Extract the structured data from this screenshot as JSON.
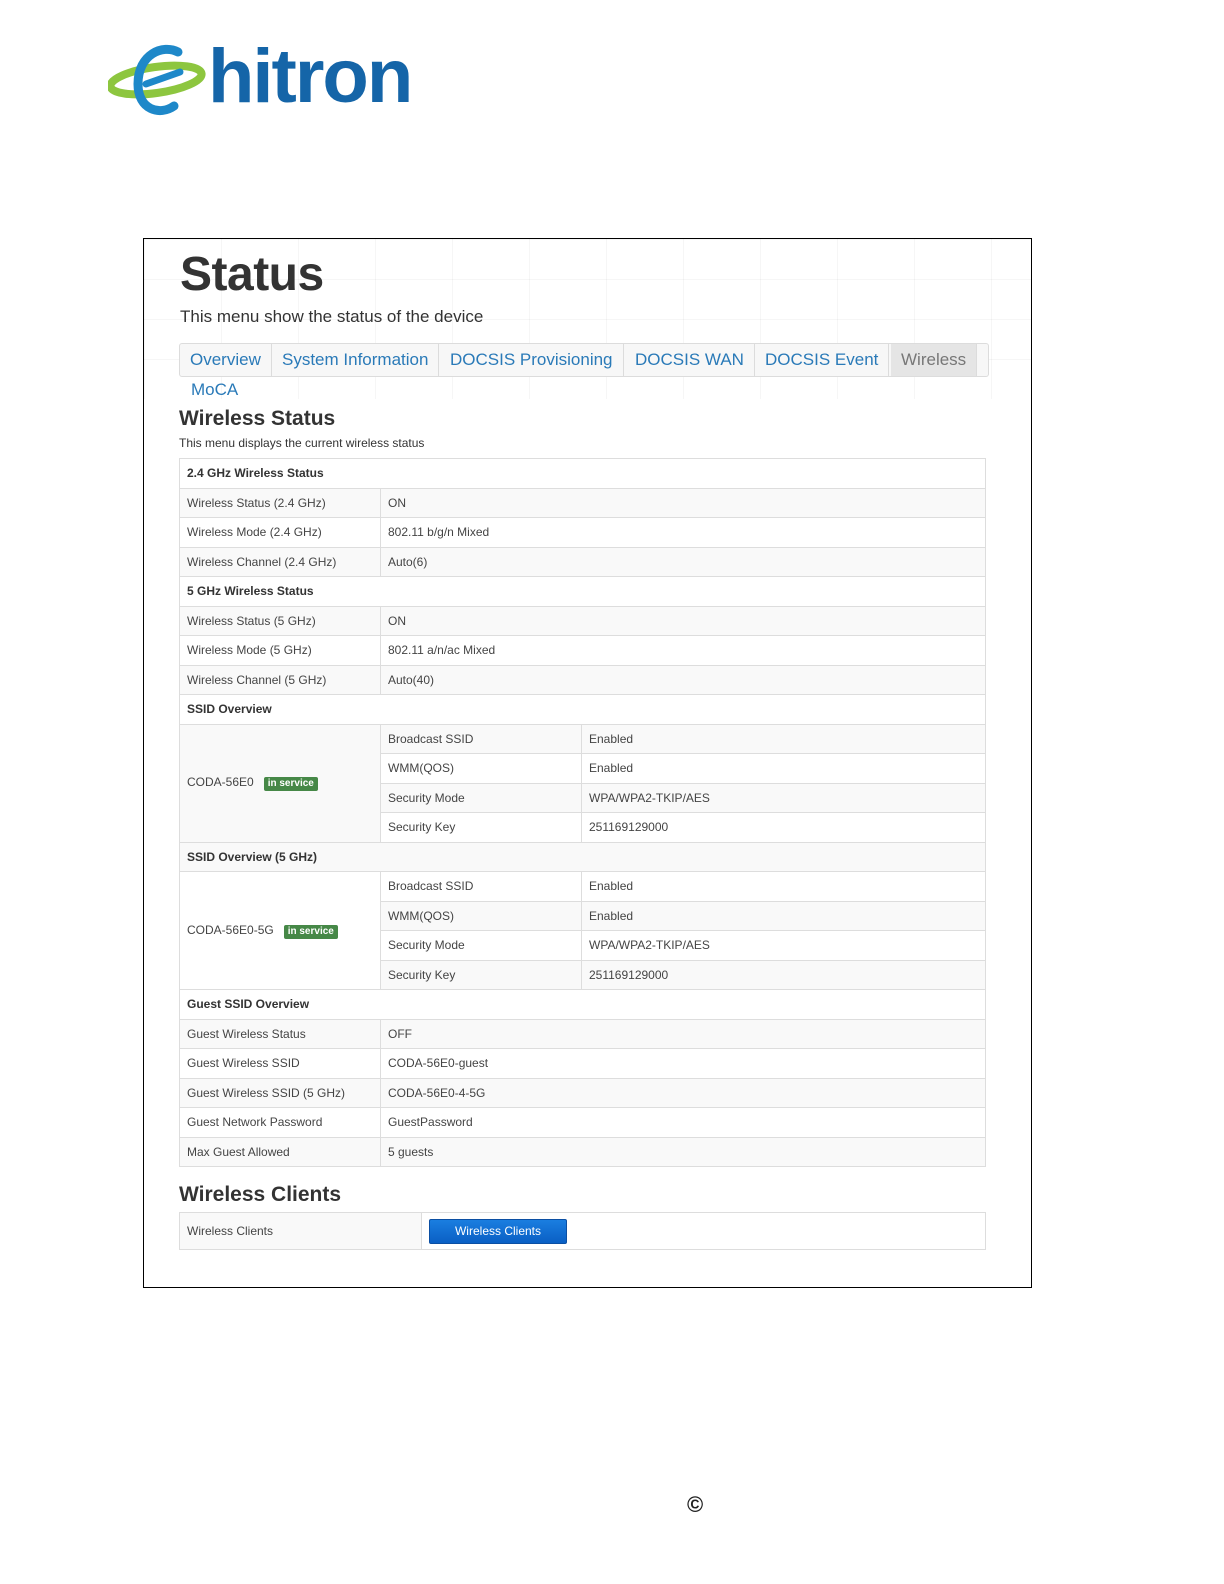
{
  "brand": {
    "logo_text": "hitron"
  },
  "page": {
    "title": "Status",
    "subtitle": "This menu show the status of the device"
  },
  "tabs": [
    {
      "label": "Overview"
    },
    {
      "label": "System Information"
    },
    {
      "label": "DOCSIS Provisioning"
    },
    {
      "label": "DOCSIS WAN"
    },
    {
      "label": "DOCSIS Event"
    },
    {
      "label": "Wireless",
      "active": true
    },
    {
      "label": "MoCA"
    }
  ],
  "wireless_status": {
    "title": "Wireless Status",
    "description": "This menu displays the current wireless status",
    "band24": {
      "header": "2.4 GHz Wireless Status",
      "rows": [
        {
          "label": "Wireless Status (2.4 GHz)",
          "value": "ON"
        },
        {
          "label": "Wireless Mode (2.4 GHz)",
          "value": "802.11 b/g/n Mixed"
        },
        {
          "label": "Wireless Channel (2.4 GHz)",
          "value": "Auto(6)"
        }
      ]
    },
    "band5": {
      "header": "5 GHz Wireless Status",
      "rows": [
        {
          "label": "Wireless Status (5 GHz)",
          "value": "ON"
        },
        {
          "label": "Wireless Mode (5 GHz)",
          "value": "802.11 a/n/ac Mixed"
        },
        {
          "label": "Wireless Channel (5 GHz)",
          "value": "Auto(40)"
        }
      ]
    },
    "ssid24": {
      "header": "SSID Overview",
      "name": "CODA-56E0",
      "badge": "in service",
      "rows": [
        {
          "label": "Broadcast SSID",
          "value": "Enabled"
        },
        {
          "label": "WMM(QOS)",
          "value": "Enabled"
        },
        {
          "label": "Security Mode",
          "value": "WPA/WPA2-TKIP/AES"
        },
        {
          "label": "Security Key",
          "value": "251169129000"
        }
      ]
    },
    "ssid5": {
      "header": "SSID Overview (5 GHz)",
      "name": "CODA-56E0-5G",
      "badge": "in service",
      "rows": [
        {
          "label": "Broadcast SSID",
          "value": "Enabled"
        },
        {
          "label": "WMM(QOS)",
          "value": "Enabled"
        },
        {
          "label": "Security Mode",
          "value": "WPA/WPA2-TKIP/AES"
        },
        {
          "label": "Security Key",
          "value": "251169129000"
        }
      ]
    },
    "guest": {
      "header": "Guest SSID Overview",
      "rows": [
        {
          "label": "Guest Wireless Status",
          "value": "OFF"
        },
        {
          "label": "Guest Wireless SSID",
          "value": "CODA-56E0-guest"
        },
        {
          "label": "Guest Wireless SSID (5 GHz)",
          "value": "CODA-56E0-4-5G"
        },
        {
          "label": "Guest Network Password",
          "value": "GuestPassword"
        },
        {
          "label": "Max Guest Allowed",
          "value": "5 guests"
        }
      ]
    }
  },
  "wireless_clients": {
    "title": "Wireless Clients",
    "label": "Wireless Clients",
    "button_label": "Wireless Clients"
  },
  "footer": {
    "copyright_symbol": "©"
  },
  "colors": {
    "brand_blue": "#1565a8",
    "logo_green": "#8dc63f",
    "tab_link": "#2a7ab8",
    "badge_green": "#468847",
    "button_blue": "#0a5fc4"
  }
}
